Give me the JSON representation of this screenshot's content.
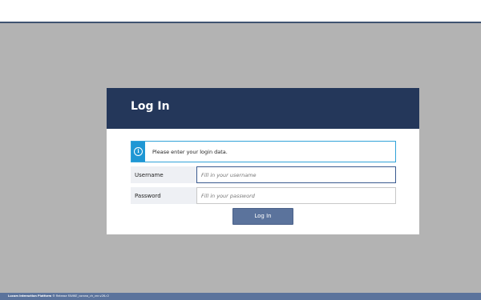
{
  "dialog": {
    "title": "Log In",
    "info_message": "Please enter your login data.",
    "info_icon": "info-icon"
  },
  "form": {
    "username_label": "Username",
    "username_placeholder": "Fill in your username",
    "username_value": "",
    "password_label": "Password",
    "password_placeholder": "Fill in your password",
    "password_value": "",
    "login_button": "Log In"
  },
  "footer": {
    "brand": "Lucom Interaction Platform",
    "separator": "®",
    "release": "Release FAVIKE_corona_ch_vnr-v26-r2"
  },
  "colors": {
    "header_bg": "#24375a",
    "accent": "#5b739c",
    "info": "#1f97d4",
    "backdrop": "#b3b3b3"
  }
}
